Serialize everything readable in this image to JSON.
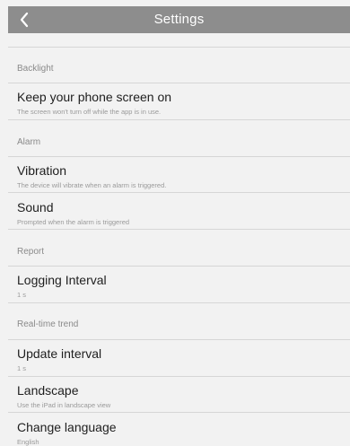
{
  "header": {
    "title": "Settings",
    "back_icon": "chevron-left-icon"
  },
  "sections": {
    "backlight": {
      "header": "Backlight",
      "keep_screen_on": {
        "title": "Keep your phone screen on",
        "subtitle": "The screen won't turn off while the app is in use."
      }
    },
    "alarm": {
      "header": "Alarm",
      "vibration": {
        "title": "Vibration",
        "subtitle": "The device will vibrate when an alarm is triggered."
      },
      "sound": {
        "title": "Sound",
        "subtitle": "Prompted when the alarm is triggered"
      }
    },
    "report": {
      "header": "Report",
      "logging_interval": {
        "title": "Logging Interval",
        "value": "1 s"
      }
    },
    "realtime_trend": {
      "header": "Real-time trend",
      "update_interval": {
        "title": "Update interval",
        "value": "1 s"
      },
      "landscape": {
        "title": "Landscape",
        "subtitle": "Use the iPad in landscape view"
      },
      "change_language": {
        "title": "Change language",
        "value": "English"
      }
    }
  },
  "colors": {
    "nav_background": "#8d8d8d",
    "page_background": "#f2f2f2",
    "divider": "#d6d6d6",
    "secondary_text": "#8a8a8a"
  }
}
